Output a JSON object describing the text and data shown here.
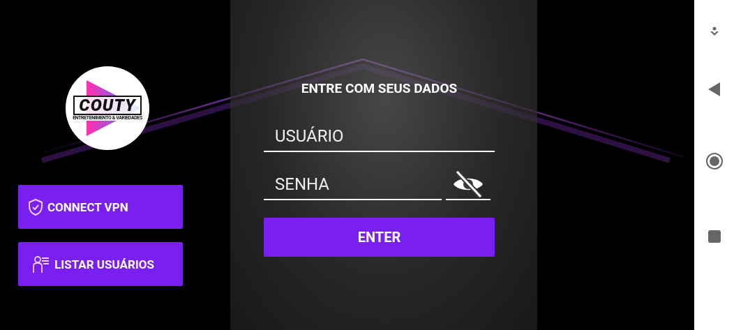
{
  "logo": {
    "title": "COUTY",
    "subtitle": "ENTRETENIMENTO & VARIEDADES"
  },
  "side_buttons": [
    {
      "label": "CONNECT VPN",
      "kind": "vpn"
    },
    {
      "label": "LISTAR USUÁRIOS",
      "kind": "users"
    }
  ],
  "login": {
    "title": "ENTRE COM SEUS DADOS",
    "username": {
      "placeholder": "USUÁRIO"
    },
    "password": {
      "placeholder": "SENHA",
      "visible": false
    },
    "submit": "ENTER"
  }
}
